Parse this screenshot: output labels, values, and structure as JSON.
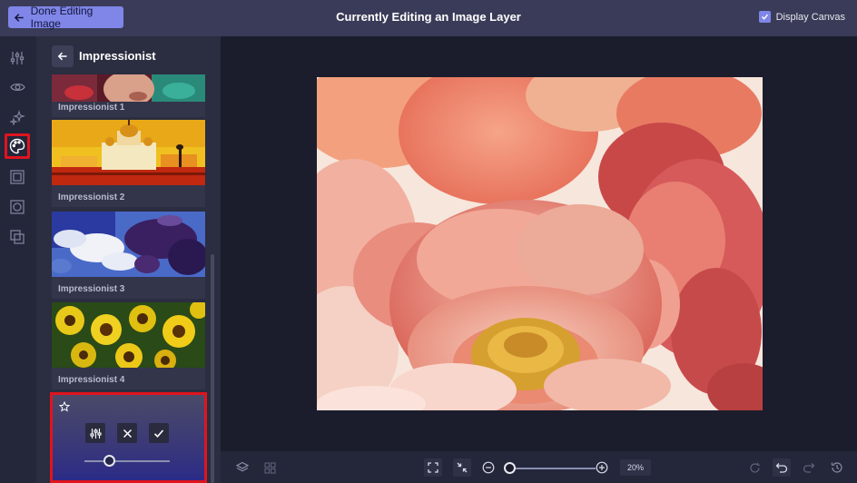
{
  "topbar": {
    "done_label": "Done Editing Image",
    "title": "Currently Editing an Image Layer",
    "display_canvas_label": "Display Canvas",
    "display_canvas_checked": true
  },
  "rail": {
    "icons": [
      "adjustments-icon",
      "eye-icon",
      "sparkles-icon",
      "palette-icon",
      "frame-icon",
      "mask-icon",
      "layers-overlap-icon"
    ],
    "active": "palette-icon"
  },
  "panel": {
    "title": "Impressionist",
    "filters": [
      {
        "label": "Impressionist 1"
      },
      {
        "label": "Impressionist 2"
      },
      {
        "label": "Impressionist 3"
      },
      {
        "label": "Impressionist 4"
      }
    ],
    "active_filter": {
      "favorite_icon": "star-icon",
      "tools": [
        "settings-sliders-icon",
        "close-icon",
        "check-icon"
      ]
    }
  },
  "bottombar": {
    "zoom_label": "20%",
    "left_icons": [
      "layers-icon",
      "grid-icon"
    ],
    "center_icons": [
      "fit-screen-icon",
      "shrink-icon",
      "zoom-out-icon",
      "zoom-in-icon"
    ],
    "right_icons": [
      "reset-icon",
      "undo-icon",
      "redo-icon",
      "history-icon"
    ]
  },
  "colors": {
    "accent": "#7f86e8",
    "highlight": "#e0141d",
    "topbar": "#3a3b58",
    "background": "#1b1d2c"
  }
}
